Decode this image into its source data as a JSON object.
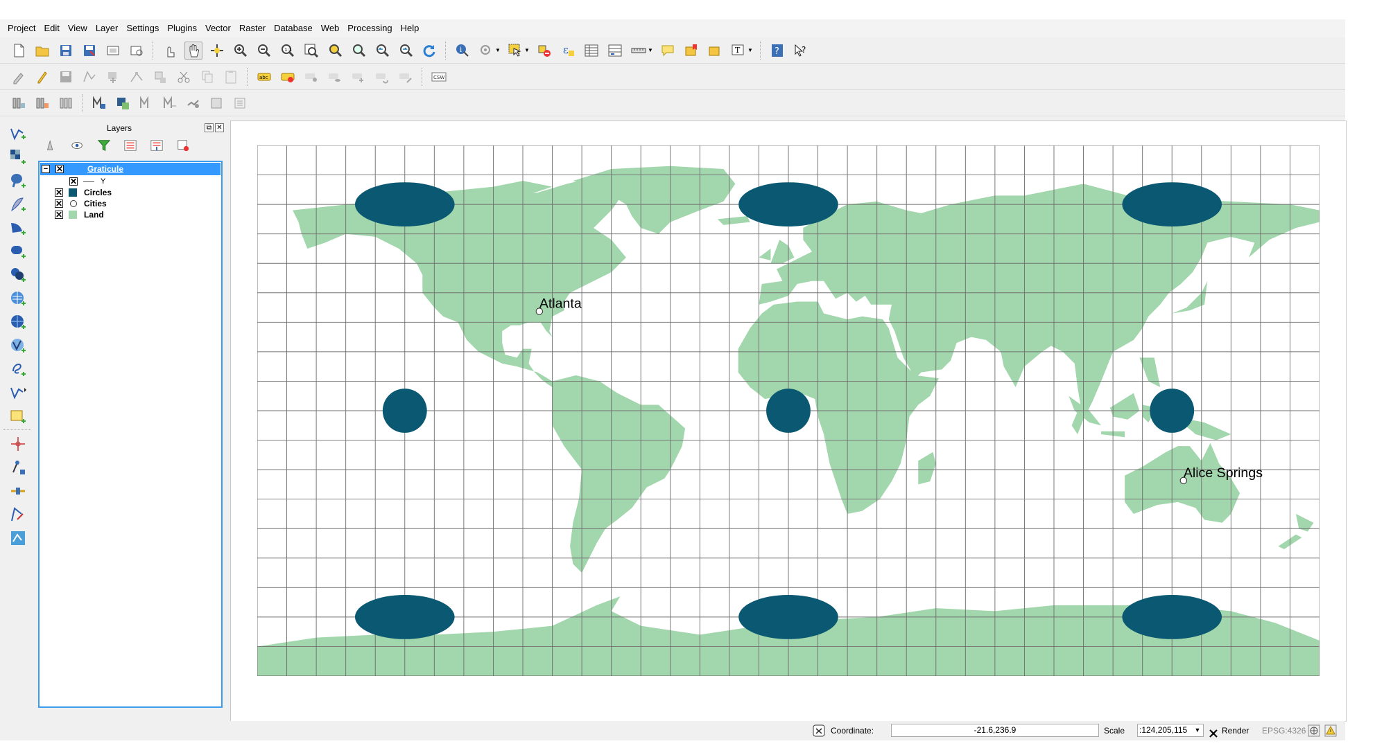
{
  "menu": [
    "Project",
    "Edit",
    "View",
    "Layer",
    "Settings",
    "Plugins",
    "Vector",
    "Raster",
    "Database",
    "Web",
    "Processing",
    "Help"
  ],
  "layers_panel": {
    "title": "Layers",
    "tree": [
      {
        "name": "Graticule",
        "checked": true,
        "selected": true,
        "expanded": true
      },
      {
        "name": "Y",
        "checked": true,
        "child": true
      },
      {
        "name": "Circles",
        "checked": true
      },
      {
        "name": "Cities",
        "checked": true
      },
      {
        "name": "Land",
        "checked": true
      }
    ],
    "check_mark": "✕",
    "collapse_mark": "−"
  },
  "map": {
    "labels": [
      {
        "name": "Atlanta",
        "lon": -84.4,
        "lat": 33.7
      },
      {
        "name": "Alice Springs",
        "lon": 133.9,
        "lat": -23.7
      }
    ],
    "colors": {
      "land": "#a2d6ac",
      "circles": "#0a5872",
      "grid": "#707070",
      "background": "#ffffff"
    },
    "circle_centers": [
      [
        -130,
        70
      ],
      [
        0,
        70
      ],
      [
        130,
        70
      ],
      [
        -130,
        0
      ],
      [
        0,
        0
      ],
      [
        130,
        0
      ],
      [
        -130,
        -70
      ],
      [
        0,
        -70
      ],
      [
        130,
        -70
      ]
    ],
    "graticule_step_degrees": 10
  },
  "statusbar": {
    "coordinate_label": "Coordinate:",
    "coordinate_value": "-21.6,236.9",
    "scale_label": "Scale",
    "scale_value": ":124,205,115",
    "render_label": "Render",
    "render_checked": true,
    "crs": "EPSG:4326"
  }
}
